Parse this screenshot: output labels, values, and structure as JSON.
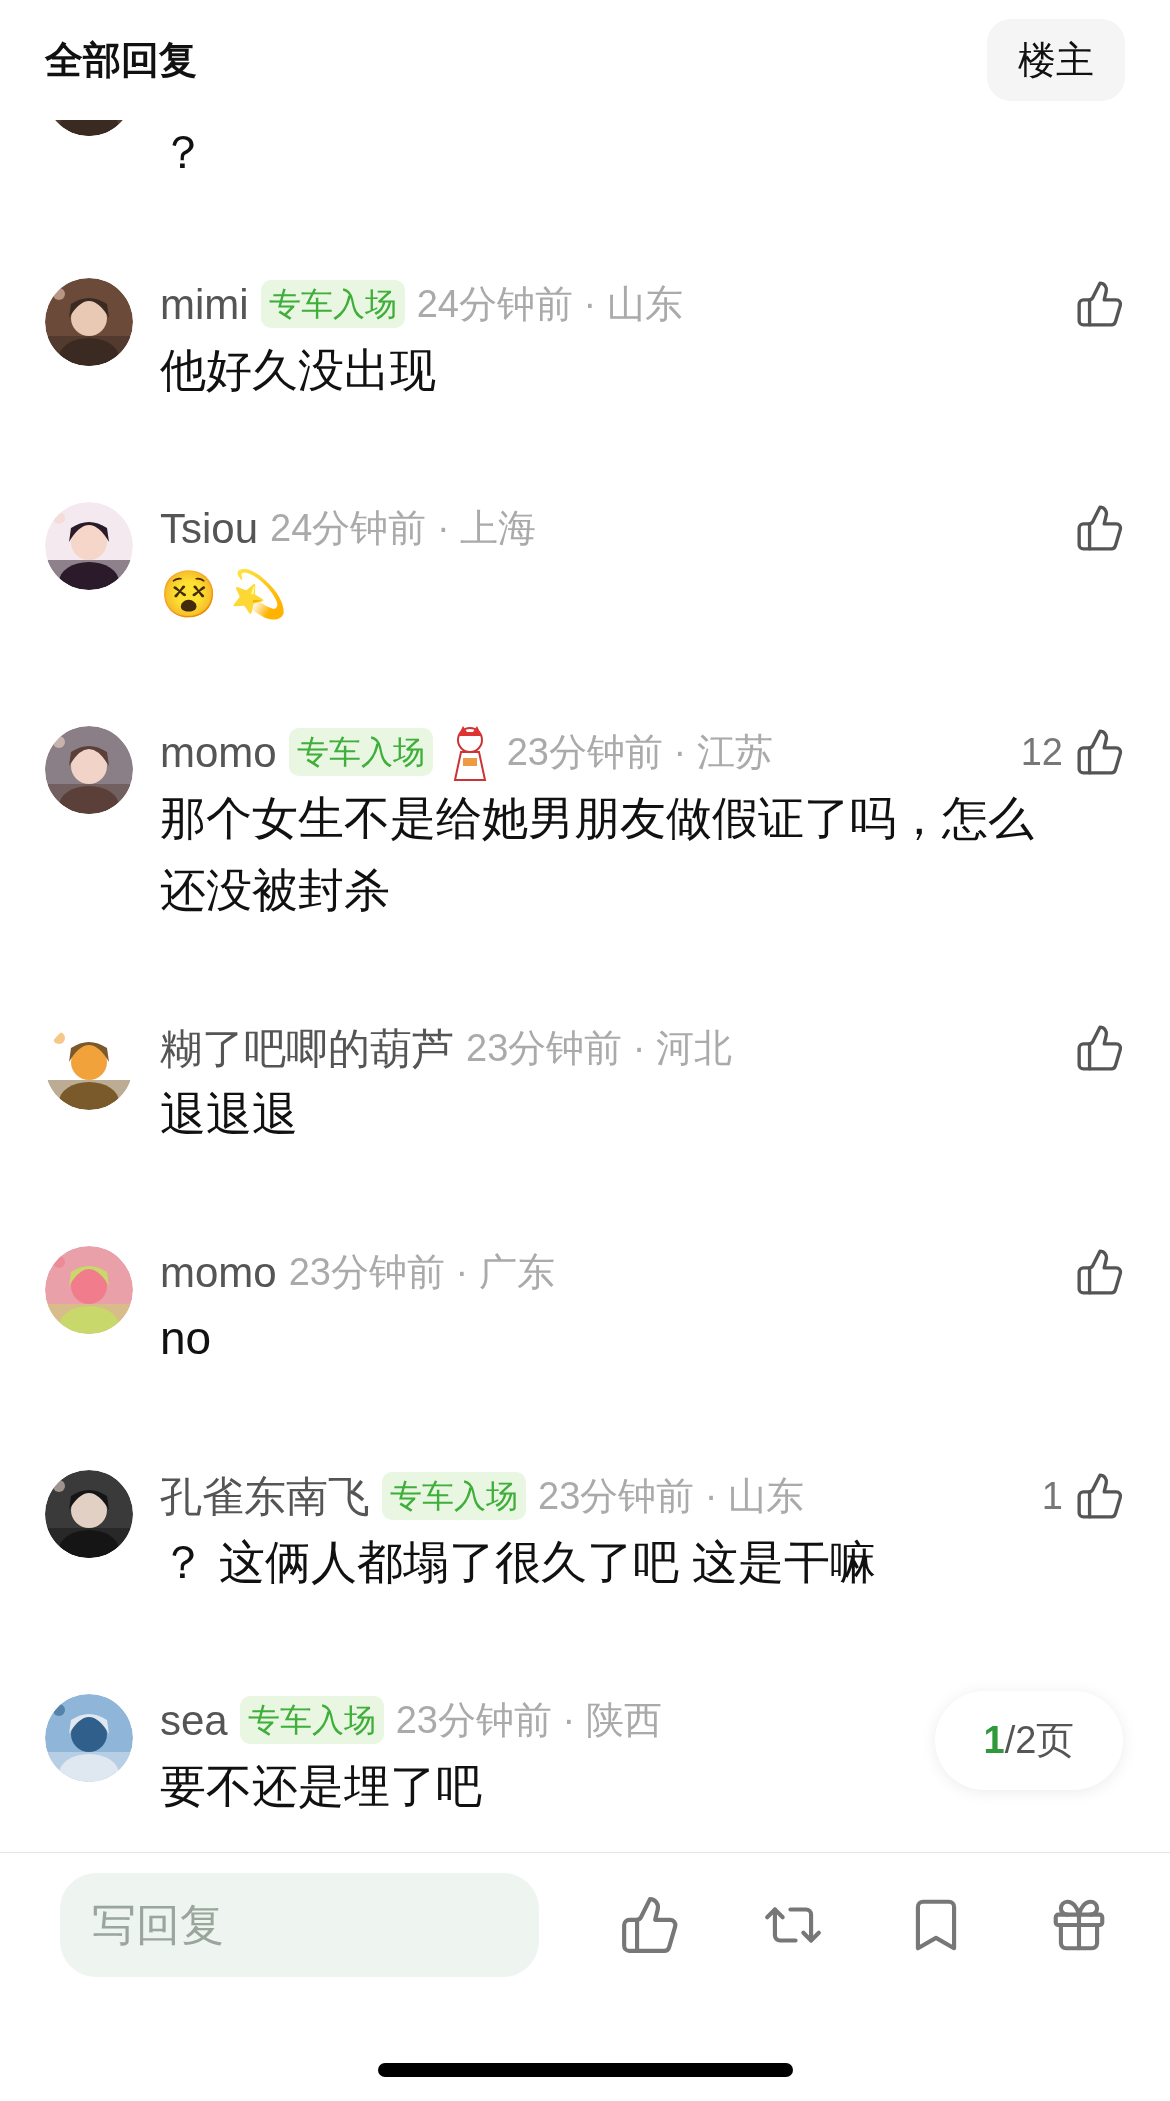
{
  "header": {
    "title": "全部回复",
    "button": "楼主"
  },
  "partial_comment": {
    "text": "？"
  },
  "comments": [
    {
      "name": "mimi",
      "badge": "专车入场",
      "meta": "24分钟前 · 山东",
      "text": "他好久没出现"
    },
    {
      "name": "Tsiou",
      "meta": "24分钟前 · 上海",
      "text": "😵 💫"
    },
    {
      "name": "momo",
      "badge": "专车入场",
      "sticker": true,
      "meta": "23分钟前 · 江苏",
      "text": "那个女生不是给她男朋友做假证了吗，怎么还没被封杀",
      "likes": "12"
    },
    {
      "name": "糊了吧唧的葫芦",
      "meta": "23分钟前 · 河北",
      "text": "退退退"
    },
    {
      "name": "momo",
      "meta": "23分钟前 · 广东",
      "text": "no"
    },
    {
      "name": "孔雀东南飞",
      "badge": "专车入场",
      "meta": "23分钟前 · 山东",
      "text": "？ 这俩人都塌了很久了吧 这是干嘛",
      "likes": "1"
    },
    {
      "name": "sea",
      "badge": "专车入场",
      "meta": "23分钟前 · 陕西",
      "text": "要不还是埋了吧"
    }
  ],
  "page_indicator": {
    "current": "1",
    "rest": "/2页"
  },
  "reply_bar": {
    "placeholder": "写回复"
  }
}
